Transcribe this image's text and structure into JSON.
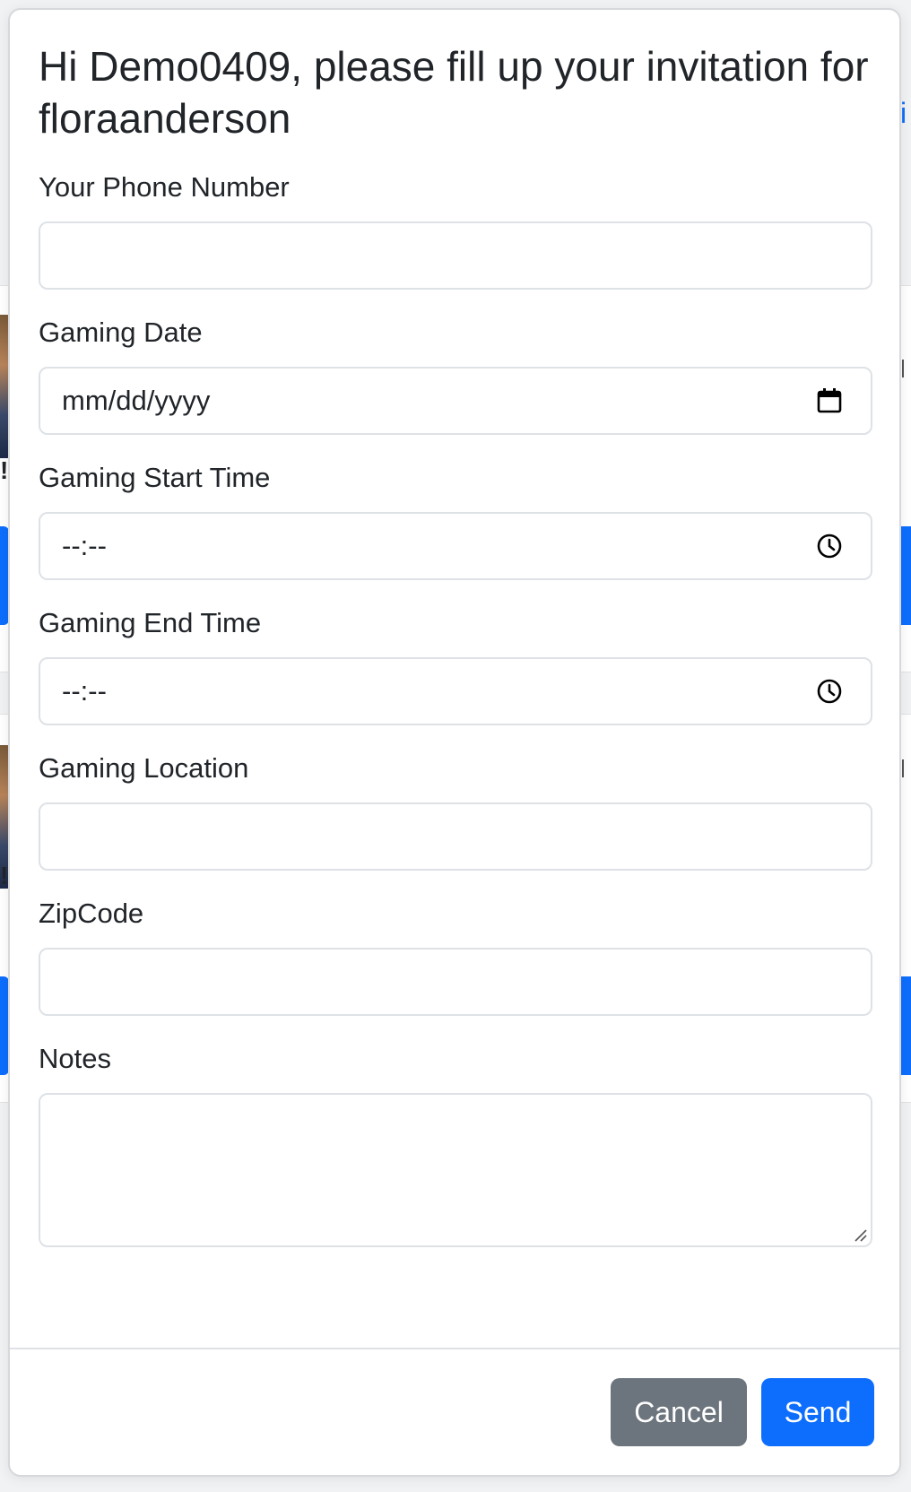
{
  "modal": {
    "title": "Hi Demo0409, please fill up your invitation for floraanderson"
  },
  "fields": {
    "phone": {
      "label": "Your Phone Number",
      "value": ""
    },
    "date": {
      "label": "Gaming Date",
      "placeholder": "mm/dd/yyyy",
      "icon": "calendar-icon"
    },
    "start_time": {
      "label": "Gaming Start Time",
      "placeholder": "--:--",
      "icon": "clock-icon"
    },
    "end_time": {
      "label": "Gaming End Time",
      "placeholder": "--:--",
      "icon": "clock-icon"
    },
    "location": {
      "label": "Gaming Location",
      "value": ""
    },
    "zipcode": {
      "label": "ZipCode",
      "value": ""
    },
    "notes": {
      "label": "Notes",
      "value": ""
    }
  },
  "footer": {
    "cancel_label": "Cancel",
    "send_label": "Send"
  },
  "colors": {
    "primary": "#0d6efd",
    "secondary": "#6c757d",
    "border": "#dee2e6",
    "text": "#212529"
  }
}
